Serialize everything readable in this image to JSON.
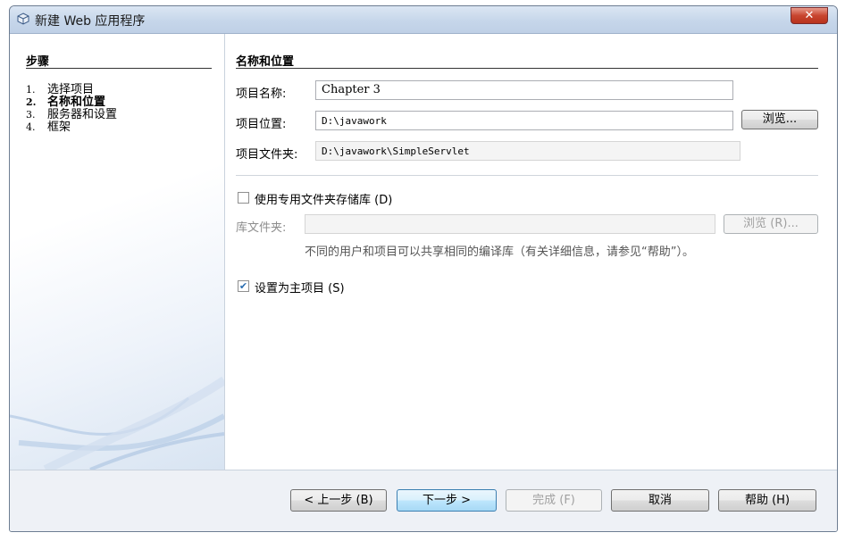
{
  "window": {
    "title": "新建 Web 应用程序",
    "close_label": "✕"
  },
  "steps": {
    "title": "步骤",
    "items": [
      {
        "num": "1.",
        "label": "选择项目"
      },
      {
        "num": "2.",
        "label": "名称和位置"
      },
      {
        "num": "3.",
        "label": "服务器和设置"
      },
      {
        "num": "4.",
        "label": "框架"
      }
    ],
    "current_index": 1
  },
  "content": {
    "section_title": "名称和位置",
    "project_name_label": "项目名称:",
    "project_name_value": "Chapter 3",
    "project_location_label": "项目位置:",
    "project_location_value": "D:\\javawork",
    "browse_label": "浏览...",
    "project_folder_label": "项目文件夹:",
    "project_folder_value": "D:\\javawork\\SimpleServlet",
    "dedicated_folder_checkbox_label": "使用专用文件夹存储库 (D)",
    "dedicated_folder_checked": false,
    "library_folder_label": "库文件夹:",
    "library_folder_value": "",
    "library_browse_label": "浏览 (R)...",
    "note_text": "不同的用户和项目可以共享相同的编译库（有关详细信息，请参见“帮助”）。",
    "main_project_checkbox_label": "设置为主项目 (S)",
    "main_project_checked": true
  },
  "footer": {
    "back_label": "< 上一步 (B)",
    "next_label": "下一步 >",
    "finish_label": "完成 (F)",
    "cancel_label": "取消",
    "help_label": "帮助 (H)"
  },
  "colors": {
    "title_bar": "#c6d6ea",
    "close_button": "#c8452f",
    "primary_button": "#bee6fd"
  }
}
